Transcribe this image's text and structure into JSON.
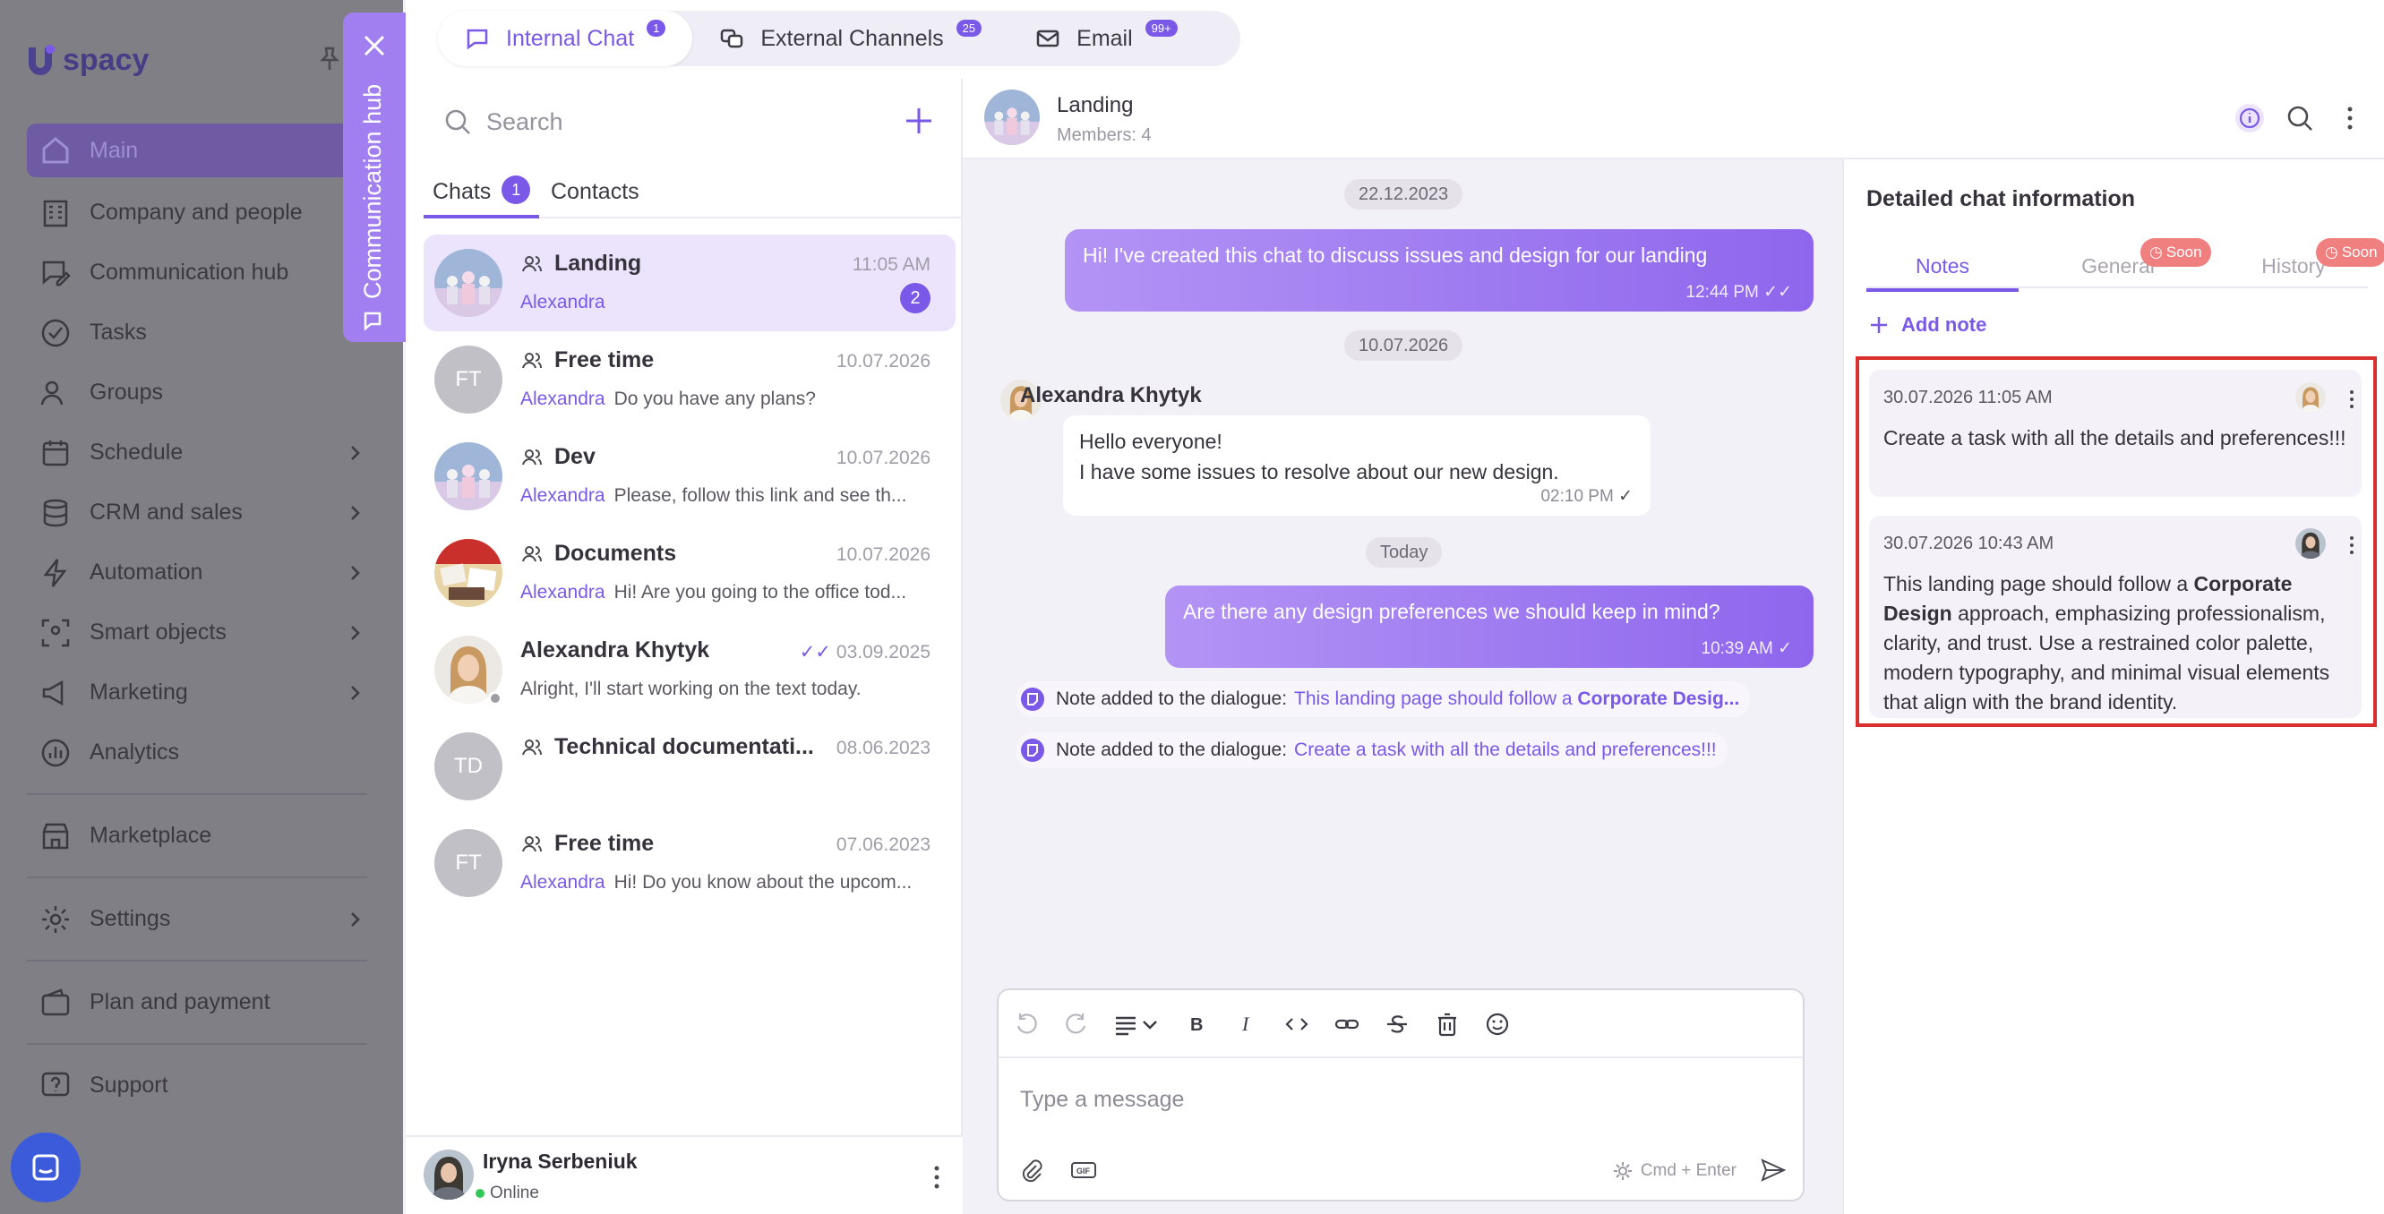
{
  "sidebar": {
    "brand": "spacy",
    "items": [
      {
        "label": "Main",
        "icon": "home-icon",
        "chevron": false,
        "active": true
      },
      {
        "label": "Company and people",
        "icon": "building-icon",
        "chevron": true
      },
      {
        "label": "Communication hub",
        "icon": "chat-edit-icon",
        "chevron": true
      },
      {
        "label": "Tasks",
        "icon": "check-circle-icon",
        "chevron": false
      },
      {
        "label": "Groups",
        "icon": "users-icon",
        "chevron": false
      },
      {
        "label": "Schedule",
        "icon": "calendar-icon",
        "chevron": true
      },
      {
        "label": "CRM and sales",
        "icon": "database-icon",
        "chevron": true
      },
      {
        "label": "Automation",
        "icon": "lightning-icon",
        "chevron": true
      },
      {
        "label": "Smart objects",
        "icon": "scan-icon",
        "chevron": true
      },
      {
        "label": "Marketing",
        "icon": "megaphone-icon",
        "chevron": true
      },
      {
        "label": "Analytics",
        "icon": "chart-icon",
        "chevron": false
      }
    ],
    "lower_items": [
      {
        "label": "Marketplace",
        "icon": "store-icon",
        "chevron": false
      },
      {
        "label": "Settings",
        "icon": "gear-icon",
        "chevron": true
      },
      {
        "label": "Plan and payment",
        "icon": "wallet-icon",
        "chevron": false
      },
      {
        "label": "Support",
        "icon": "help-icon",
        "chevron": false
      }
    ]
  },
  "hub_panel": {
    "title": "Communication hub"
  },
  "top_tabs": [
    {
      "label": "Internal Chat",
      "badge": "1",
      "icon": "chat-bubble-icon"
    },
    {
      "label": "External Channels",
      "badge": "25",
      "icon": "channels-icon"
    },
    {
      "label": "Email",
      "badge": "99+",
      "icon": "mail-icon"
    }
  ],
  "chat_list": {
    "search_placeholder": "Search",
    "tabs": [
      {
        "label": "Chats",
        "count": "1"
      },
      {
        "label": "Contacts"
      }
    ],
    "items": [
      {
        "title": "Landing",
        "date": "11:05 AM",
        "who": "Alexandra",
        "preview": "",
        "unread": "2",
        "initials": "",
        "group": true,
        "active": true
      },
      {
        "title": "Free time",
        "date": "10.07.2026",
        "who": "Alexandra",
        "preview": "Do you have any plans?",
        "initials": "FT",
        "group": true
      },
      {
        "title": "Dev",
        "date": "10.07.2026",
        "who": "Alexandra",
        "preview": "Please, follow this link and see th...",
        "initials": "",
        "group": true
      },
      {
        "title": "Documents",
        "date": "10.07.2026",
        "who": "Alexandra",
        "preview": "Hi! Are you going to the office tod...",
        "initials": "",
        "group": true
      },
      {
        "title": "Alexandra Khytyk",
        "date": "03.09.2025",
        "who": "",
        "preview": "Alright, I'll start working on the text today.",
        "initials": "",
        "group": false
      },
      {
        "title": "Technical documentati...",
        "date": "08.06.2023",
        "who": "",
        "preview": "",
        "initials": "TD",
        "group": true
      },
      {
        "title": "Free time",
        "date": "07.06.2023",
        "who": "Alexandra",
        "preview": "Hi! Do you know about the upcom...",
        "initials": "FT",
        "group": true
      }
    ],
    "me": {
      "name": "Iryna Serbeniuk",
      "status": "Online"
    }
  },
  "conversation": {
    "title": "Landing",
    "members": "Members: 4",
    "dates": [
      "22.12.2023",
      "10.07.2026",
      "Today"
    ],
    "msg1": {
      "text": "Hi! I've created this chat to discuss issues and design for our landing",
      "time": "12:44 PM"
    },
    "sender": "Alexandra Khytyk",
    "msg2": {
      "line1": "Hello everyone!",
      "line2": "I have some issues to resolve about our new design.",
      "time": "02:10 PM"
    },
    "msg3": {
      "text": "Are there any design preferences we should keep in mind?",
      "time": "10:39 AM"
    },
    "note1": {
      "prefix": "Note added to the dialogue:",
      "link": "This landing page should follow a ",
      "link_bold": "Corporate Desig..."
    },
    "note2": {
      "prefix": "Note added to the dialogue:",
      "link": "Create a task with all the details and preferences!!!"
    },
    "composer": {
      "placeholder": "Type a message",
      "hint": "Cmd + Enter"
    }
  },
  "details": {
    "title": "Detailed chat information",
    "tabs": [
      {
        "label": "Notes"
      },
      {
        "label": "General",
        "soon": "Soon"
      },
      {
        "label": "History",
        "soon": "Soon"
      }
    ],
    "add_note": "Add note",
    "notes": [
      {
        "date": "30.07.2026 11:05 AM",
        "text": "Create a task with all the details and preferences!!!"
      },
      {
        "date": "30.07.2026 10:43 AM",
        "t1": "This landing page should follow a ",
        "bold": "Corporate Design",
        "t2": " approach, emphasizing professionalism, clarity, and trust. Use a restrained color palette, modern typography, and minimal visual elements that align with the brand identity."
      }
    ]
  },
  "colors": {
    "accent": "#7a58e8",
    "highlight": "#d9302f",
    "soon": "#f07f7f"
  }
}
